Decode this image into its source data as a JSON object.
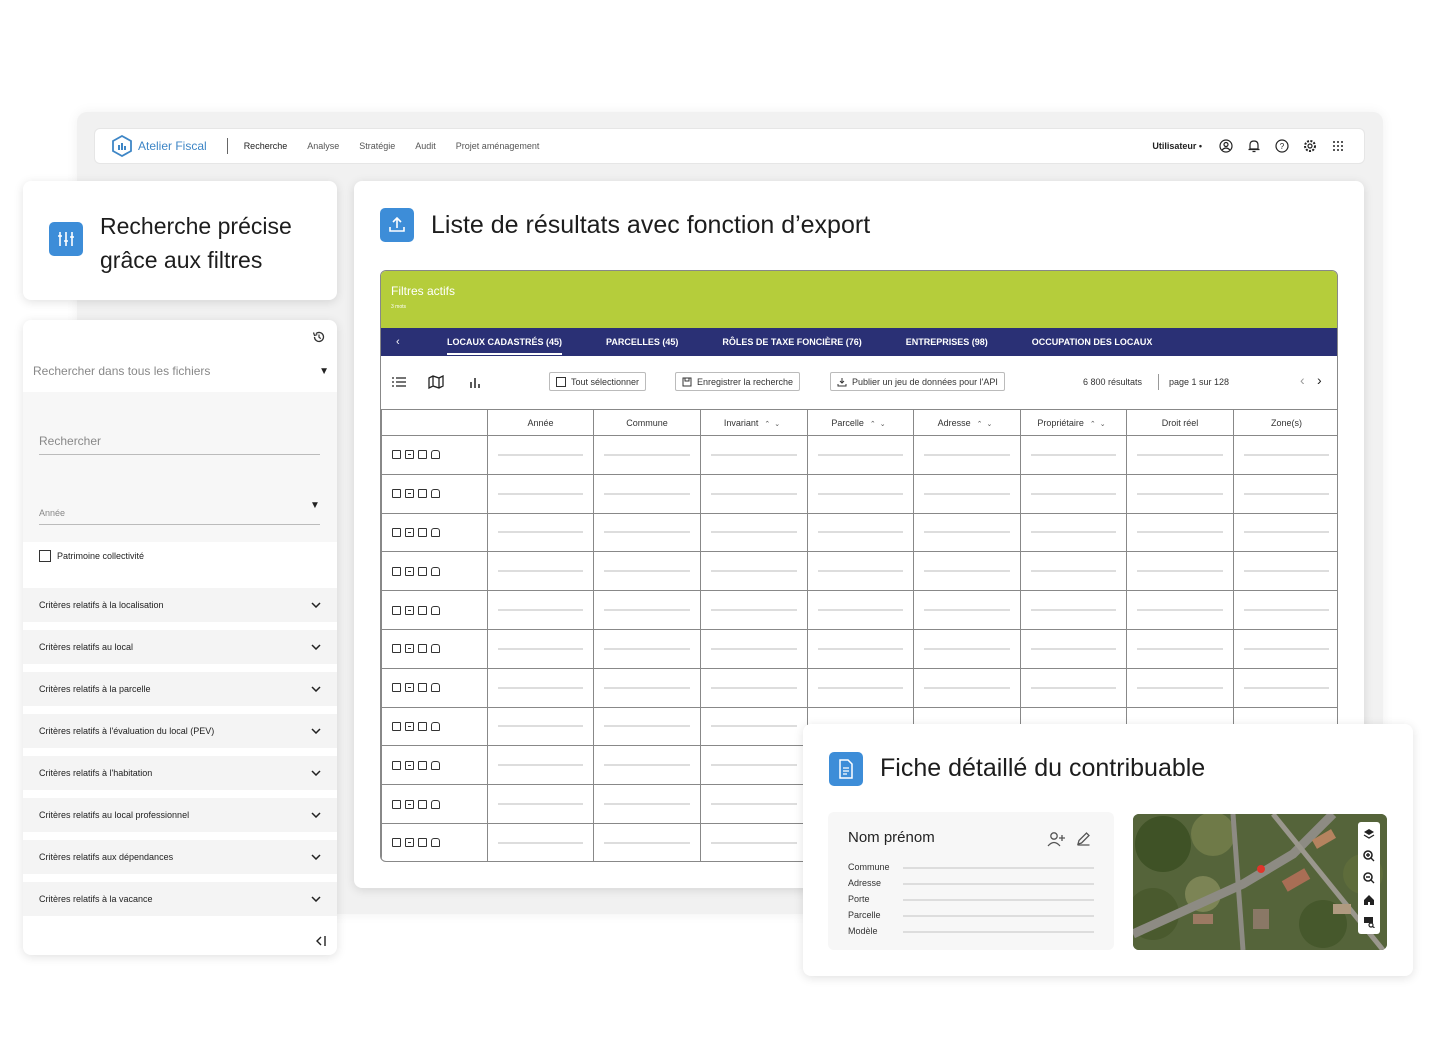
{
  "app": {
    "brand": "Atelier Fiscal",
    "nav": [
      "Recherche",
      "Analyse",
      "Stratégie",
      "Audit",
      "Projet aménagement"
    ],
    "user": "Utilisateur"
  },
  "filters_card": {
    "title_line1": "Recherche précise",
    "title_line2": "grâce aux filtres"
  },
  "filters": {
    "search_files_placeholder": "Rechercher dans tous les fichiers",
    "search_label": "Rechercher",
    "year_label": "Année",
    "checkbox_label": "Patrimoine collectivité",
    "criteria": [
      "Critères relatifs à la localisation",
      "Critères relatifs au local",
      "Critères relatifs à la parcelle",
      "Critères relatifs à l'évaluation du local (PEV)",
      "Critères relatifs à l'habitation",
      "Critères relatifs au local professionnel",
      "Critères relatifs aux dépendances",
      "Critères relatifs à la vacance"
    ]
  },
  "results_card": {
    "title": "Liste de résultats avec fonction d’export",
    "active_filters_title": "Filtres actifs",
    "active_filters_sub": "3 mots",
    "tabs": [
      "LOCAUX CADASTRÉS (45)",
      "PARCELLES (45)",
      "RÔLES DE TAXE FONCIÈRE (76)",
      "ENTREPRISES (98)",
      "OCCUPATION DES LOCAUX"
    ],
    "toolbar": {
      "select_all": "Tout sélectionner",
      "save_search": "Enregistrer la recherche",
      "publish": "Publier un jeu de données pour l'API",
      "count": "6 800 résultats",
      "page": "page 1 sur 128"
    },
    "columns": [
      "Année",
      "Commune",
      "Invariant",
      "Parcelle",
      "Adresse",
      "Propriétaire",
      "Droit réel",
      "Zone(s)"
    ],
    "row_count": 11
  },
  "contributor_card": {
    "title": "Fiche détaillé du contribuable",
    "name": "Nom prénom",
    "fields": [
      "Commune",
      "Adresse",
      "Porte",
      "Parcelle",
      "Modèle"
    ]
  },
  "colors": {
    "accent": "#3d8dd8",
    "green": "#b5cd3b",
    "navy": "#2a3075"
  }
}
